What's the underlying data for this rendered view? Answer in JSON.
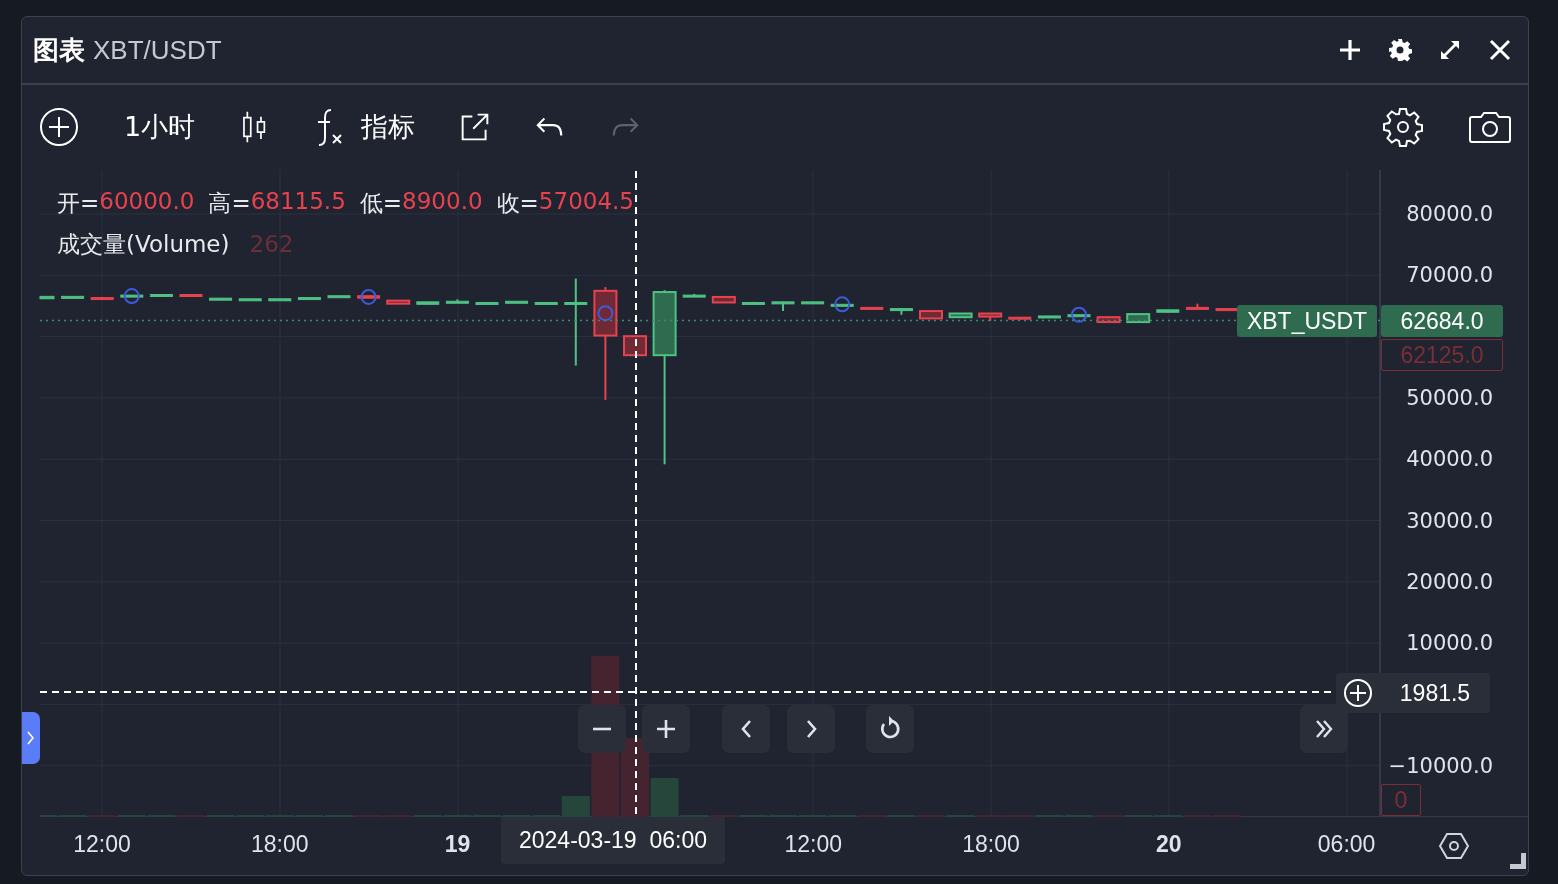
{
  "window": {
    "title_prefix": "图表",
    "title": "XBT/USDT"
  },
  "toolbar": {
    "interval": "1小时",
    "indicators": "指标",
    "redo": {
      "disabled": true
    }
  },
  "legend": {
    "fields": [
      {
        "label": "开=",
        "value": "60000.0"
      },
      {
        "label": "高=",
        "value": "68115.5"
      },
      {
        "label": "低=",
        "value": "8900.0"
      },
      {
        "label": "收=",
        "value": "57004.5"
      }
    ],
    "volume": {
      "label": "成交量(Volume)",
      "value": "262"
    }
  },
  "price_axis": {
    "ticks": [
      "80000.0",
      "70000.0",
      "50000.0",
      "40000.0",
      "30000.0",
      "20000.0",
      "10000.0",
      "−10000.0"
    ]
  },
  "last_price": {
    "symbol": "XBT_USDT",
    "value": "62684.0"
  },
  "price_marker": "62125.0",
  "volume_marker": "0",
  "crosshair": {
    "price": "1981.5",
    "time": "2024-03-19  06:00"
  },
  "time_axis": {
    "ticks": [
      {
        "label": "12:00",
        "bold": false
      },
      {
        "label": "18:00",
        "bold": false
      },
      {
        "label": "19",
        "bold": true
      },
      {
        "label": "12:00",
        "bold": false
      },
      {
        "label": "18:00",
        "bold": false
      },
      {
        "label": "20",
        "bold": true
      },
      {
        "label": "06:00",
        "bold": false
      }
    ]
  }
}
